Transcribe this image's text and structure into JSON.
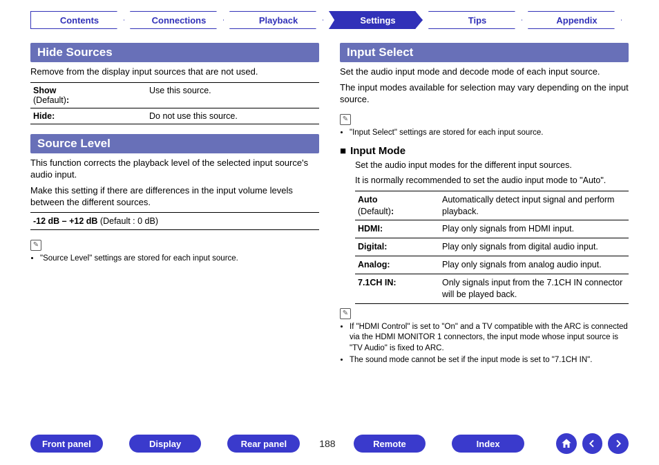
{
  "nav": {
    "tabs": [
      "Contents",
      "Connections",
      "Playback",
      "Settings",
      "Tips",
      "Appendix"
    ],
    "active_index": 3
  },
  "left": {
    "hideSources": {
      "title": "Hide Sources",
      "intro": "Remove from the display input sources that are not used.",
      "rows": [
        {
          "keyBold": "Show",
          "keyPlain": "(Default)",
          "keyTrail": ":",
          "desc": "Use this source."
        },
        {
          "keyBold": "Hide:",
          "keyPlain": "",
          "keyTrail": "",
          "desc": "Do not use this source."
        }
      ]
    },
    "sourceLevel": {
      "title": "Source Level",
      "p1": "This function corrects the playback level of the selected input source's audio input.",
      "p2": "Make this setting if there are differences in the input volume levels between the different sources.",
      "rangeBold": "-12 dB – +12 dB",
      "rangePlain": " (Default : 0 dB)",
      "noteIcon": "✎",
      "notes": [
        "\"Source Level\" settings are stored for each input source."
      ]
    }
  },
  "right": {
    "inputSelect": {
      "title": "Input Select",
      "p1": "Set the audio input mode and decode mode of each input source.",
      "p2": "The input modes available for selection may vary depending on the input source.",
      "noteIcon": "✎",
      "notes1": [
        "\"Input Select\" settings are stored for each input source."
      ]
    },
    "inputMode": {
      "bullet": "■",
      "title": "Input Mode",
      "p1": "Set the audio input modes for the different input sources.",
      "p2": "It is normally recommended to set the audio input mode to \"Auto\".",
      "rows": [
        {
          "keyBold": "Auto",
          "keyPlain": "(Default)",
          "keyTrail": ":",
          "desc": "Automatically detect input signal and perform playback."
        },
        {
          "keyBold": "HDMI:",
          "keyPlain": "",
          "keyTrail": "",
          "desc": "Play only signals from HDMI input."
        },
        {
          "keyBold": "Digital:",
          "keyPlain": "",
          "keyTrail": "",
          "desc": "Play only signals from digital audio input."
        },
        {
          "keyBold": "Analog:",
          "keyPlain": "",
          "keyTrail": "",
          "desc": "Play only signals from analog audio input."
        },
        {
          "keyBold": "7.1CH IN:",
          "keyPlain": "",
          "keyTrail": "",
          "desc": "Only signals input from the 7.1CH IN connector will be played back."
        }
      ],
      "noteIcon": "✎",
      "notes2": [
        "If \"HDMI Control\" is set to \"On\" and a TV compatible with the ARC is connected via the HDMI MONITOR 1 connectors, the input mode whose input source is \"TV Audio\" is fixed to ARC.",
        "The sound mode cannot be set if the input mode is set to \"7.1CH IN\"."
      ]
    }
  },
  "bottom": {
    "pills": [
      "Front panel",
      "Display",
      "Rear panel",
      "Remote",
      "Index"
    ],
    "page": "188"
  }
}
